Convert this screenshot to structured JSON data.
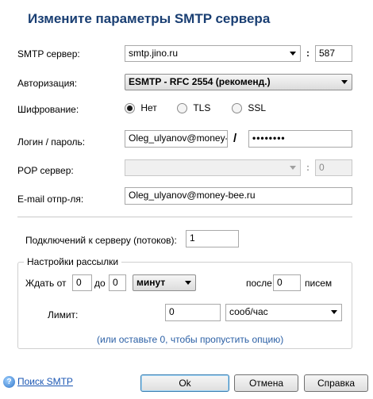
{
  "title": "Измените параметры SMTP сервера",
  "smtp": {
    "label": "SMTP сервер:",
    "server": "smtp.jino.ru",
    "colon": ":",
    "port": "587"
  },
  "auth": {
    "label": "Авторизация:",
    "value": "ESMTP - RFC 2554 (рекоменд.)"
  },
  "encryption": {
    "label": "Шифрование:",
    "options": [
      "Нет",
      "TLS",
      "SSL"
    ],
    "selected": "Нет"
  },
  "login": {
    "label": "Логин / пароль:",
    "username": "Oleg_ulyanov@money-b",
    "separator": "/",
    "password": "••••••••"
  },
  "pop": {
    "label": "POP сервер:",
    "server": "",
    "colon": ":",
    "port": "0"
  },
  "sender": {
    "label": "E-mail отпр-ля:",
    "value": "Oleg_ulyanov@money-bee.ru"
  },
  "connections": {
    "label": "Подключений к серверу (потоков):",
    "value": "1"
  },
  "mailing": {
    "legend": "Настройки рассылки",
    "wait_from_label": "Ждать от",
    "wait_from": "0",
    "to_label": "до",
    "wait_to": "0",
    "unit": "минут",
    "after_label": "после",
    "after_value": "0",
    "letters_label": "писем",
    "limit_label": "Лимит:",
    "limit_value": "0",
    "limit_unit": "сооб/час",
    "hint": "(или оставьте 0, чтобы пропустить опцию)"
  },
  "footer": {
    "help_icon_glyph": "?",
    "search_link": "Поиск SMTP",
    "ok": "Ok",
    "cancel": "Отмена",
    "help": "Справка"
  }
}
